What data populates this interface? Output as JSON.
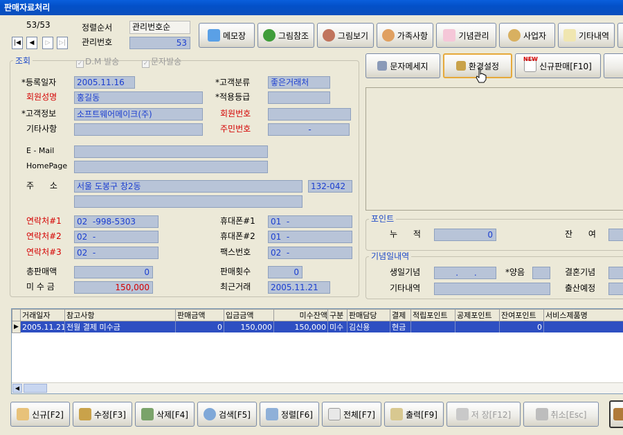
{
  "window": {
    "title": "판매자료처리"
  },
  "nav": {
    "counter": "53/53",
    "first": "|◀",
    "prev": "◀",
    "next": "▷",
    "last": "▷|"
  },
  "sort": {
    "sort_label": "정렬순서",
    "sort_value": "관리번호순",
    "mgmt_label": "관리번호",
    "mgmt_value": "53"
  },
  "toolbar": {
    "memo": "메모장",
    "picture_ref": "그림참조",
    "picture_view": "그림보기",
    "family": "가족사항",
    "anniversary": "기념관리",
    "business": "사업자",
    "other": "기타내역",
    "sms": "문자메세지",
    "settings": "환경설정",
    "new_sale": "신규판매[F10]",
    "new_badge": "NEW"
  },
  "search_group": {
    "title": "조회",
    "dm_label": "D.M 발송",
    "sms_label": "문자발송"
  },
  "customer": {
    "reg_date_label": "*등록일자",
    "reg_date": "2005.11.16",
    "class_label": "*고객분류",
    "class_value": "좋은거래처",
    "name_label": "회원성명",
    "name": "홍길동",
    "grade_label": "*적용등급",
    "grade": "",
    "info_label": "*고객정보",
    "info": "소프트웨어메이크(주)",
    "member_no_label": "회원번호",
    "member_no": "",
    "misc_label": "기타사항",
    "misc": "",
    "resident_label": "주민번호",
    "resident": "-",
    "email_label": "E - Mail",
    "email": "",
    "homepage_label": "HomePage",
    "homepage": "",
    "address_label": "주      소",
    "address": "서울 도봉구 창2동",
    "zip": "132-042",
    "address2": "",
    "phone1_label": "연락처#1",
    "phone1": "02  -998-5303",
    "phone2_label": "연락처#2",
    "phone2": "02  -",
    "phone3_label": "연락처#3",
    "phone3": "02  -",
    "mobile1_label": "휴대폰#1",
    "mobile1": "01  -",
    "mobile2_label": "휴대폰#2",
    "mobile2": "01  -",
    "fax_label": "팩스번호",
    "fax": "02  -",
    "total_sales_label": "총판매액",
    "total_sales": "0",
    "sales_count_label": "판매횟수",
    "sales_count": "0",
    "unpaid_label": "미 수 금",
    "unpaid": "150,000",
    "recent_label": "최근거래",
    "recent": "2005.11.21"
  },
  "points": {
    "title": "포인트",
    "accum_label": "누      적",
    "accum": "0",
    "remain_label": "잔      여",
    "remain": ""
  },
  "anniv": {
    "title": "기념일내역",
    "birthday_label": "생일기념",
    "birthday": ".      .",
    "lunar_label": "*양음",
    "lunar": "",
    "wedding_label": "결혼기념",
    "wedding": "",
    "other_label": "기타내역",
    "other": "",
    "birth_label": "출산예정",
    "birth": ""
  },
  "grid": {
    "headers": [
      "거래일자",
      "참고사항",
      "판매금액",
      "입금금액",
      "미수잔액",
      "구분",
      "판매담당",
      "결제",
      "적립포인트",
      "공제포인트",
      "잔여포인트",
      "서비스제품명"
    ],
    "rows": [
      [
        "2005.11.21",
        "전월 결제 미수금",
        "0",
        "150,000",
        "150,000",
        "미수",
        "김신용",
        "현금",
        "",
        "",
        "0",
        ""
      ]
    ]
  },
  "bottom": {
    "new": "신규[F2]",
    "edit": "수정[F3]",
    "delete": "삭제[F4]",
    "search": "검색[F5]",
    "sort": "정렬[F6]",
    "all": "전체[F7]",
    "print": "출력[F9]",
    "save": "저 장[F12]",
    "cancel": "취소[Esc]"
  },
  "colors": {
    "titlebar": "#0350c8",
    "field_bg": "#b8c4d8",
    "field_text": "#1b3ecf",
    "required_red": "#d40000",
    "selected_row": "#2e4fc2"
  }
}
